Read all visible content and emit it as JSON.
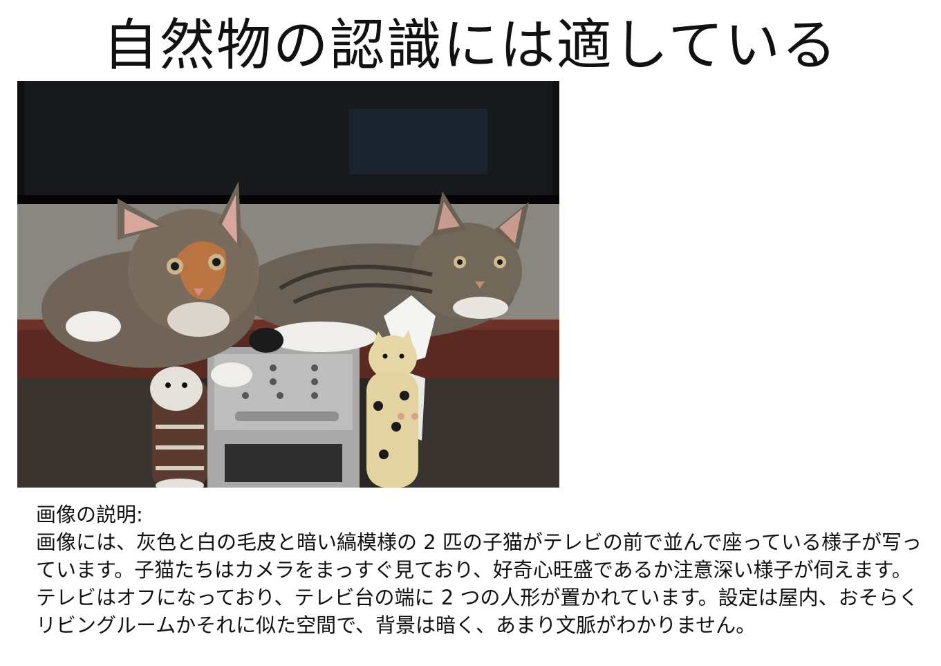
{
  "slide": {
    "title": "自然物の認識には適している"
  },
  "caption": {
    "label": "画像の説明:",
    "body": "画像には、灰色と白の毛皮と暗い縞模様の 2 匹の子猫がテレビの前で並んで座っている様子が写っています。子猫たちはカメラをまっすぐ見ており、好奇心旺盛であるか注意深い様子が伺えます。テレビはオフになっており、テレビ台の端に 2 つの人形が置かれています。設定は屋内、おそらくリビングルームかそれに似た空間で、背景は暗く、あまり文脈がわかりません。"
  },
  "colors": {
    "text": "#111111",
    "background": "#ffffff"
  }
}
